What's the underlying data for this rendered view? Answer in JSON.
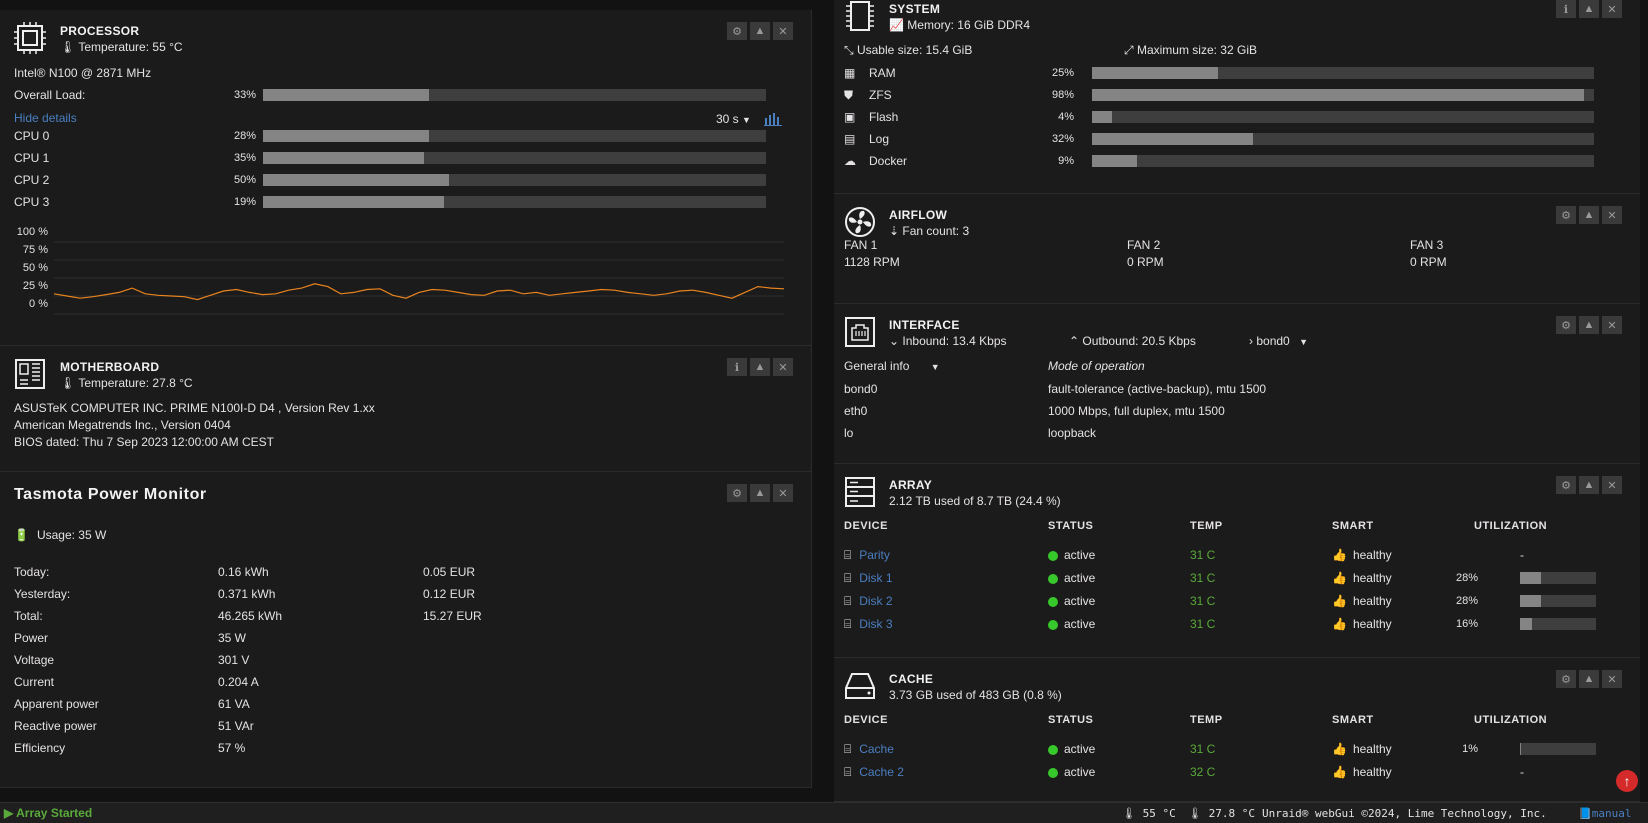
{
  "processor": {
    "title": "PROCESSOR",
    "temperature": "Temperature: 55 °C",
    "model": "Intel® N100 @ 2871 MHz",
    "overall_label": "Overall Load:",
    "overall_pct": "33%",
    "overall_value": 33,
    "hide_details": "Hide details",
    "interval": "30 s",
    "cpus": [
      {
        "label": "CPU 0",
        "pct": "28%",
        "value": 33
      },
      {
        "label": "CPU 1",
        "pct": "35%",
        "value": 32
      },
      {
        "label": "CPU 2",
        "pct": "50%",
        "value": 37
      },
      {
        "label": "CPU 3",
        "pct": "19%",
        "value": 36
      }
    ],
    "graph_ticks": [
      "100 %",
      "75 %",
      "50 %",
      "25 %",
      "0 %"
    ],
    "graph_values": [
      28,
      25,
      22,
      24,
      27,
      30,
      36,
      28,
      26,
      25,
      24,
      20,
      26,
      32,
      34,
      30,
      27,
      28,
      33,
      36,
      42,
      38,
      28,
      30,
      34,
      35,
      26,
      22,
      30,
      34,
      33,
      30,
      27,
      26,
      32,
      33,
      28,
      30,
      26,
      28,
      30,
      32,
      34,
      33,
      30,
      28,
      26,
      28,
      32,
      33,
      30,
      26,
      22,
      30,
      38,
      36,
      35
    ]
  },
  "motherboard": {
    "title": "MOTHERBOARD",
    "temperature": "Temperature: 27.8 °C",
    "line1": "ASUSTeK COMPUTER INC. PRIME N100I-D D4 , Version Rev 1.xx",
    "line2": "American Megatrends Inc., Version 0404",
    "line3": "BIOS dated: Thu 7 Sep 2023 12:00:00 AM CEST"
  },
  "tasmota": {
    "title": "Tasmota Power Monitor",
    "usage": "Usage: 35 W",
    "rows": [
      {
        "label": "Today:",
        "value": "0.16 kWh",
        "cost": "0.05 EUR"
      },
      {
        "label": "Yesterday:",
        "value": "0.371 kWh",
        "cost": "0.12 EUR"
      },
      {
        "label": "Total:",
        "value": "46.265 kWh",
        "cost": "15.27 EUR"
      },
      {
        "label": "Power",
        "value": "35 W",
        "cost": ""
      },
      {
        "label": "Voltage",
        "value": "301 V",
        "cost": ""
      },
      {
        "label": "Current",
        "value": "0.204 A",
        "cost": ""
      },
      {
        "label": "Apparent power",
        "value": "61 VA",
        "cost": ""
      },
      {
        "label": "Reactive power",
        "value": "51 VAr",
        "cost": ""
      },
      {
        "label": "Efficiency",
        "value": "57 %",
        "cost": ""
      }
    ]
  },
  "system": {
    "title": "SYSTEM",
    "memory": "Memory: 16 GiB DDR4",
    "usable": "Usable size: 15.4 GiB",
    "maximum": "Maximum size: 32 GiB",
    "rows": [
      {
        "label": "RAM",
        "pct": "25%",
        "value": 25
      },
      {
        "label": "ZFS",
        "pct": "98%",
        "value": 98
      },
      {
        "label": "Flash",
        "pct": "4%",
        "value": 4
      },
      {
        "label": "Log",
        "pct": "32%",
        "value": 32
      },
      {
        "label": "Docker",
        "pct": "9%",
        "value": 9
      }
    ]
  },
  "airflow": {
    "title": "AIRFLOW",
    "count": "Fan count: 3",
    "fans": [
      {
        "name": "FAN 1",
        "rpm": "1128 RPM"
      },
      {
        "name": "FAN 2",
        "rpm": "0 RPM"
      },
      {
        "name": "FAN 3",
        "rpm": "0 RPM"
      }
    ]
  },
  "interface": {
    "title": "INTERFACE",
    "inbound": "Inbound: 13.4 Kbps",
    "outbound": "Outbound: 20.5 Kbps",
    "iface": "bond0",
    "general": "General info",
    "mode_header": "Mode of operation",
    "rows": [
      {
        "name": "bond0",
        "value": "fault-tolerance (active-backup), mtu 1500"
      },
      {
        "name": "eth0",
        "value": "1000 Mbps, full duplex, mtu 1500"
      },
      {
        "name": "lo",
        "value": "loopback"
      }
    ]
  },
  "array": {
    "title": "ARRAY",
    "summary": "2.12 TB used of 8.7 TB (24.4 %)",
    "headers": [
      "DEVICE",
      "STATUS",
      "TEMP",
      "SMART",
      "UTILIZATION"
    ],
    "rows": [
      {
        "device": "Parity",
        "status": "active",
        "temp": "31 C",
        "smart": "healthy",
        "util": "-",
        "value": null
      },
      {
        "device": "Disk 1",
        "status": "active",
        "temp": "31 C",
        "smart": "healthy",
        "util": "28%",
        "value": 28
      },
      {
        "device": "Disk 2",
        "status": "active",
        "temp": "31 C",
        "smart": "healthy",
        "util": "28%",
        "value": 28
      },
      {
        "device": "Disk 3",
        "status": "active",
        "temp": "31 C",
        "smart": "healthy",
        "util": "16%",
        "value": 16
      }
    ]
  },
  "cache": {
    "title": "CACHE",
    "summary": "3.73 GB used of 483 GB (0.8 %)",
    "headers": [
      "DEVICE",
      "STATUS",
      "TEMP",
      "SMART",
      "UTILIZATION"
    ],
    "rows": [
      {
        "device": "Cache",
        "status": "active",
        "temp": "31 C",
        "smart": "healthy",
        "util": "1%",
        "value": 1
      },
      {
        "device": "Cache 2",
        "status": "active",
        "temp": "32 C",
        "smart": "healthy",
        "util": "-",
        "value": null
      }
    ]
  },
  "footer": {
    "status": "Array Started",
    "cpu_temp": "55 °C",
    "mb_temp": "27.8 °C",
    "copyright": "Unraid® webGui ©2024, Lime Technology, Inc.",
    "manual": "manual"
  }
}
